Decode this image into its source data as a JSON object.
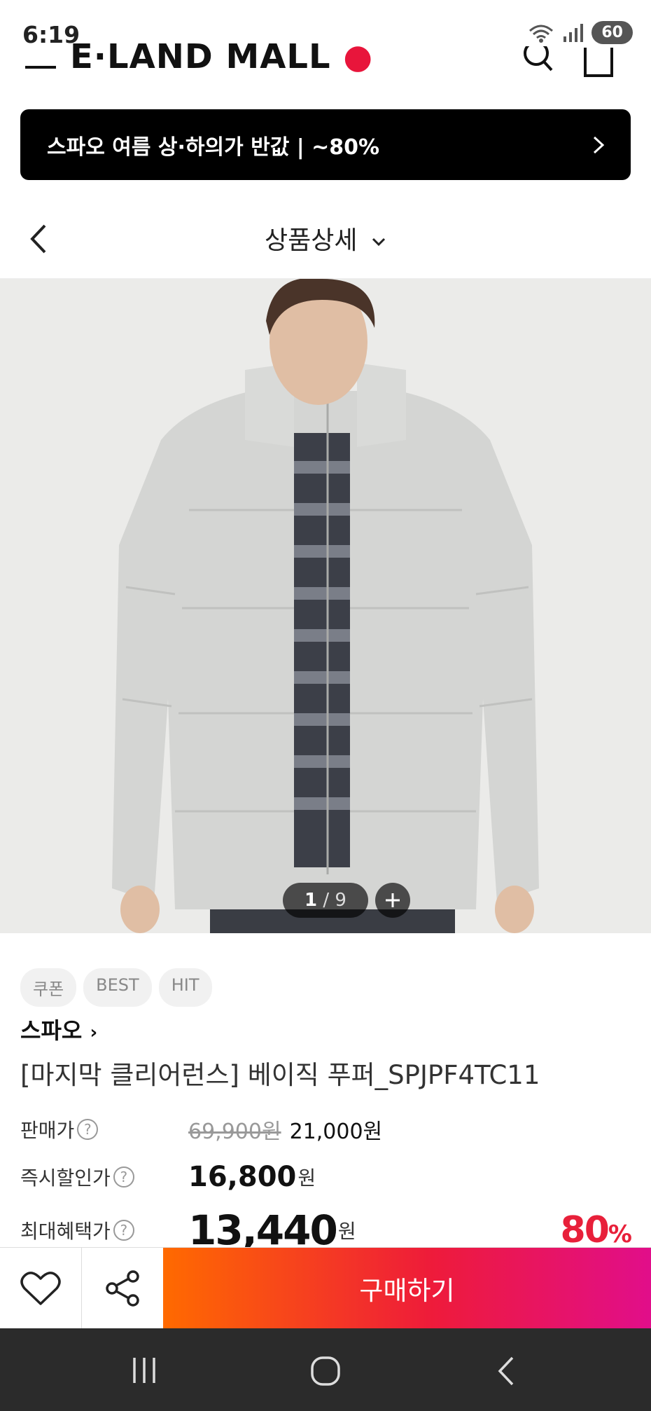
{
  "status_bar": {
    "time": "6:19",
    "battery": "60"
  },
  "header": {
    "logo": "E·LAND MALL"
  },
  "promo": {
    "text": "스파오 여름 상·하의가 반값 | ~80%"
  },
  "page_nav": {
    "title": "상품상세"
  },
  "gallery": {
    "current": "1",
    "separator": "/",
    "total": "9"
  },
  "product": {
    "tags": [
      "쿠폰",
      "BEST",
      "HIT"
    ],
    "brand": "스파오",
    "name": "[마지막 클리어런스] 베이직 푸퍼_SPJPF4TC11"
  },
  "prices": {
    "sale_label": "판매가",
    "original": "69,900원",
    "sale": "21,000원",
    "instant_label": "즉시할인가",
    "instant": "16,800",
    "instant_unit": "원",
    "max_label": "최대혜택가",
    "max": "13,440",
    "max_unit": "원",
    "discount": "80",
    "discount_unit": "%"
  },
  "actions": {
    "buy_label": "구매하기"
  },
  "colors": {
    "brand_red": "#e8203a",
    "buy_gradient_start": "#ff6a00",
    "buy_gradient_end": "#e10e8a"
  }
}
